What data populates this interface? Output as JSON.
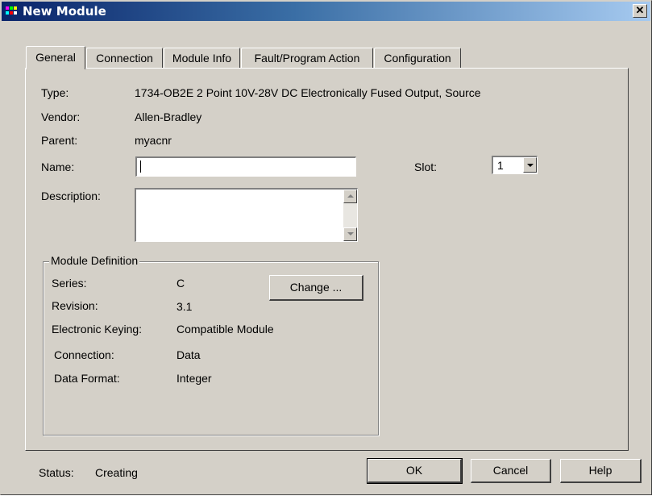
{
  "window": {
    "title": "New Module",
    "close_glyph": "✕"
  },
  "tabs": [
    {
      "label": "General",
      "active": true
    },
    {
      "label": "Connection",
      "active": false
    },
    {
      "label": "Module Info",
      "active": false
    },
    {
      "label": "Fault/Program Action",
      "active": false
    },
    {
      "label": "Configuration",
      "active": false
    }
  ],
  "general": {
    "type_label": "Type:",
    "type_value": "1734-OB2E 2 Point 10V-28V DC Electronically Fused Output, Source",
    "vendor_label": "Vendor:",
    "vendor_value": "Allen-Bradley",
    "parent_label": "Parent:",
    "parent_value": "myacnr",
    "name_label": "Name:",
    "name_value": "",
    "description_label": "Description:",
    "description_value": "",
    "slot_label": "Slot:",
    "slot_value": "1"
  },
  "module_definition": {
    "title": "Module Definition",
    "series_label": "Series:",
    "series_value": "C",
    "revision_label": "Revision:",
    "revision_value": "3.1",
    "keying_label": "Electronic Keying:",
    "keying_value": "Compatible Module",
    "connection_label": "Connection:",
    "connection_value": "Data",
    "data_format_label": "Data Format:",
    "data_format_value": "Integer",
    "change_button": "Change ..."
  },
  "footer": {
    "status_label": "Status:",
    "status_value": "Creating",
    "ok_button": "OK",
    "cancel_button": "Cancel",
    "help_button": "Help"
  },
  "colors": {
    "titlebar_start": "#0a246a",
    "titlebar_end": "#a6caf0",
    "face": "#d4d0c8"
  }
}
